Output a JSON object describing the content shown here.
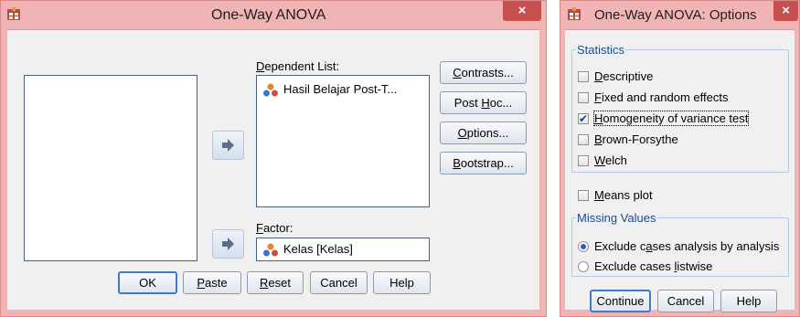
{
  "anova": {
    "title": "One-Way ANOVA",
    "close_label": "×",
    "dependent_label": "Dependent List:",
    "dependent_items": [
      "Hasil Belajar Post-T..."
    ],
    "factor_label": "Factor:",
    "factor_value": "Kelas [Kelas]",
    "side_buttons": [
      {
        "pre": "",
        "u": "C",
        "post": "ontrasts..."
      },
      {
        "pre": "Post ",
        "u": "H",
        "post": "oc..."
      },
      {
        "pre": "",
        "u": "O",
        "post": "ptions..."
      },
      {
        "pre": "",
        "u": "B",
        "post": "ootstrap..."
      }
    ],
    "bottom_buttons": {
      "ok": "OK",
      "paste": {
        "u": "P",
        "post": "aste"
      },
      "reset": {
        "u": "R",
        "post": "eset"
      },
      "cancel": "Cancel",
      "help": "Help"
    }
  },
  "options": {
    "title": "One-Way ANOVA: Options",
    "close_label": "×",
    "statistics_legend": "Statistics",
    "statistics": [
      {
        "u": "D",
        "post": "escriptive",
        "checked": false
      },
      {
        "u": "F",
        "post": "ixed and random effects",
        "checked": false
      },
      {
        "u": "H",
        "post": "omogeneity of variance test",
        "checked": true
      },
      {
        "u": "B",
        "post": "rown-Forsythe",
        "checked": false
      },
      {
        "u": "W",
        "post": "elch",
        "checked": false
      }
    ],
    "means_plot": {
      "u": "M",
      "post": "eans plot",
      "checked": false
    },
    "missing_legend": "Missing Values",
    "missing": [
      {
        "pre": "Exclude c",
        "u": "a",
        "post": "ses analysis by analysis",
        "selected": true
      },
      {
        "pre": "Exclude cases ",
        "u": "l",
        "post": "istwise",
        "selected": false
      }
    ],
    "buttons": {
      "continue": "Continue",
      "cancel": "Cancel",
      "help": "Help"
    }
  }
}
